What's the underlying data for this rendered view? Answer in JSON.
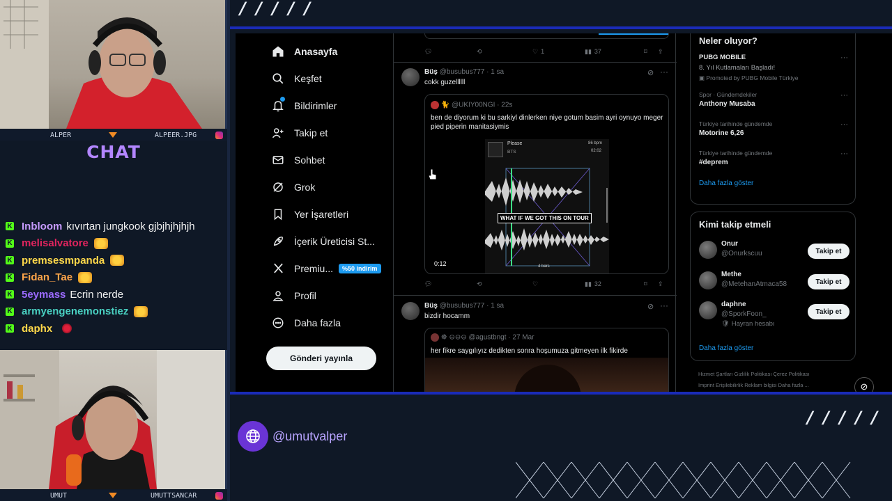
{
  "overlay": {
    "slashes_top": "/ / / / /",
    "slashes_bottom": "/ / / / /",
    "cam1": {
      "name_left": "ALPER",
      "name_right": "ALPEER.JPG"
    },
    "cam2": {
      "name_left": "UMUT",
      "name_right": "UMUTTSANCAR"
    },
    "chat_title": "CHAT",
    "social_handle": "@umutvalper"
  },
  "chat": [
    {
      "user": "Inbloom",
      "color": "#c79bff",
      "msg": "kıvırtan jungkook gjbjhjhjhjh",
      "emote": ""
    },
    {
      "user": "melisalvatore",
      "color": "#e0245e",
      "msg": "",
      "emote": "fire"
    },
    {
      "user": "premsesmpanda",
      "color": "#ffd84a",
      "msg": "",
      "emote": "fire"
    },
    {
      "user": "Fidan_Tae",
      "color": "#ffa54a",
      "msg": "",
      "emote": "fire"
    },
    {
      "user": "5eymass",
      "color": "#9b6bff",
      "msg": "Ecrin nerde",
      "emote": ""
    },
    {
      "user": "armyengenemonstiez",
      "color": "#49d0c1",
      "msg": "",
      "emote": "fire"
    },
    {
      "user": "daphx",
      "color": "#ffd84a",
      "msg": "",
      "emote": "red"
    }
  ],
  "nav": {
    "items": [
      {
        "label": "Anasayfa",
        "icon": "home-icon",
        "active": true
      },
      {
        "label": "Keşfet",
        "icon": "search-icon"
      },
      {
        "label": "Bildirimler",
        "icon": "bell-icon"
      },
      {
        "label": "Takip et",
        "icon": "person-add-icon"
      },
      {
        "label": "Sohbet",
        "icon": "mail-icon"
      },
      {
        "label": "Grok",
        "icon": "grok-icon"
      },
      {
        "label": "Yer İşaretleri",
        "icon": "bookmark-icon"
      },
      {
        "label": "İçerik Üreticisi St...",
        "icon": "rocket-icon"
      },
      {
        "label": "Premiu...",
        "icon": "x-logo-icon",
        "badge": "%50 indirim"
      },
      {
        "label": "Profil",
        "icon": "profile-icon"
      },
      {
        "label": "Daha fazla",
        "icon": "more-circle-icon"
      }
    ],
    "post_button": "Gönderi yayınla"
  },
  "feed": {
    "top_actions": {
      "likes": "1",
      "views": "37"
    },
    "tweet1": {
      "name": "Büş",
      "handle": "@busubus777 · 1 sa",
      "text": "cokk guzellllll",
      "quote": {
        "author": "@UKIY00NGI · 22s",
        "text": "ben de diyorum ki bu sarkiyl dinlerken niye gotum basim ayri oynuyo meger pied piperin manitasiymis",
        "media": {
          "song": "Please",
          "artist": "BTS",
          "bpm": "86 bpm",
          "time_small": "02:02",
          "caption": "WHAT IF WE GOT THIS ON TOUR",
          "bars": "4 bars",
          "duration": "0:12"
        }
      },
      "views": "32"
    },
    "tweet2": {
      "name": "Büş",
      "handle": "@busubus777 · 1 sa",
      "text": "bizdir hocamm",
      "quote": {
        "author": "☸ ⊖⊖⊖ @agustbngt · 27 Mar",
        "text": "her fikre saygılıyız dedikten sonra hoşumuza gitmeyen ilk fikirde"
      }
    }
  },
  "trends": {
    "title": "Neler oluyor?",
    "items": [
      {
        "cat": "PUBG MOBILE",
        "title": "8. Yıl Kutlamaları Başladı!",
        "extra": "Promoted by PUBG Mobile Türkiye"
      },
      {
        "cat": "Spor · Gündemdekiler",
        "title": "Anthony Musaba"
      },
      {
        "cat": "Türkiye tarihinde gündemde",
        "title": "Motorine 6,26"
      },
      {
        "cat": "Türkiye tarihinde gündemde",
        "title": "#deprem"
      }
    ],
    "more": "Daha fazla göster"
  },
  "who_to_follow": {
    "title": "Kimi takip etmeli",
    "items": [
      {
        "name": "Onur",
        "handle": "@Onurkscuu",
        "extra": ""
      },
      {
        "name": "Methe",
        "handle": "@MetehanAtmaca58",
        "extra": ""
      },
      {
        "name": "daphne",
        "handle": "@SporkFoon_",
        "extra": "Hayran hesabı"
      }
    ],
    "follow_label": "Takip et",
    "more": "Daha fazla göster"
  },
  "footer": {
    "line1": "Hizmet Şartları   Gizlilik Politikası   Çerez Politikası",
    "line2": "Imprint   Erişilebilirlik   Reklam bilgisi   Daha fazla ..."
  }
}
